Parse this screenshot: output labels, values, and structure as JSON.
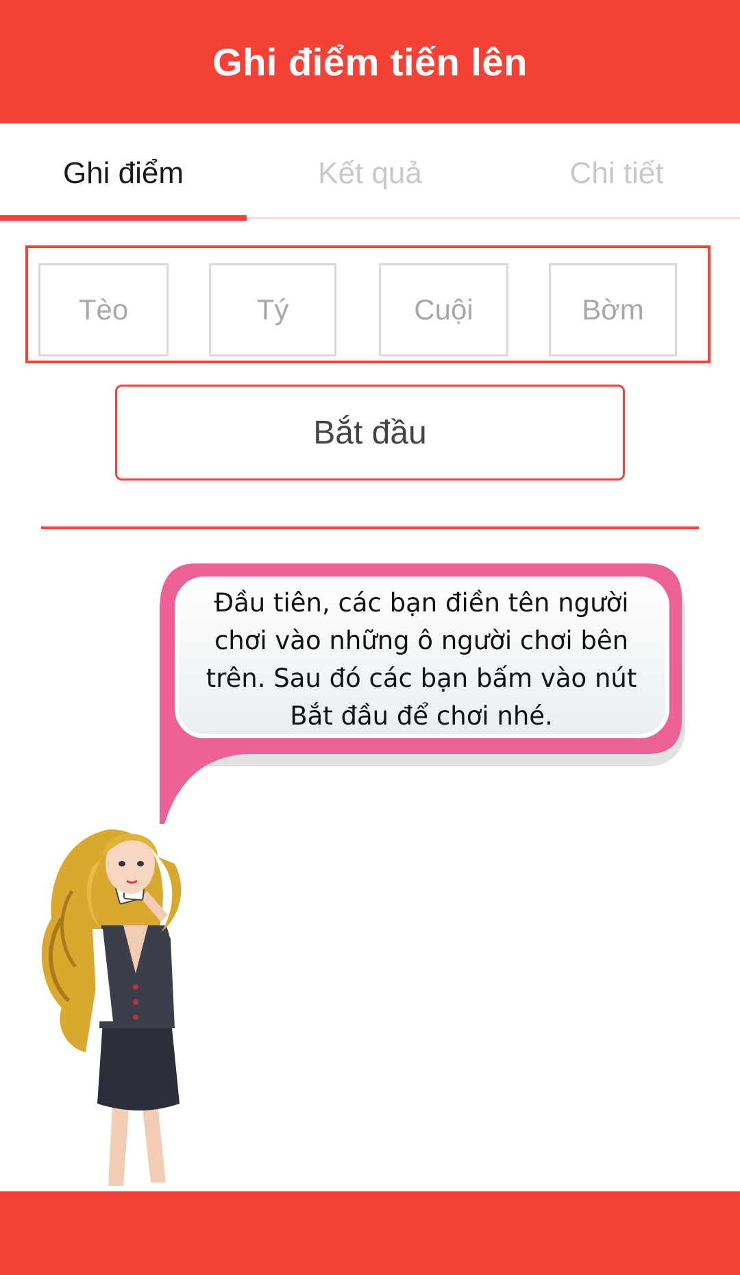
{
  "app": {
    "title": "Ghi điểm tiến lên"
  },
  "colors": {
    "primary": "#f44336",
    "bubble_pink": "#ee6196",
    "tab_inactive": "#c8c8c8"
  },
  "tabs": [
    {
      "label": "Ghi điểm",
      "active": true
    },
    {
      "label": "Kết quả",
      "active": false
    },
    {
      "label": "Chi tiết",
      "active": false
    }
  ],
  "players": [
    {
      "placeholder": "Tèo",
      "value": ""
    },
    {
      "placeholder": "Tý",
      "value": ""
    },
    {
      "placeholder": "Cuội",
      "value": ""
    },
    {
      "placeholder": "Bờm",
      "value": ""
    }
  ],
  "start_button": {
    "label": "Bắt đầu"
  },
  "guide": {
    "message": "Đầu tiên, các bạn điền tên người chơi vào những ô người chơi bên trên. Sau đó các bạn bấm vào nút Bắt đầu để chơi nhé.",
    "character_icon": "card-dealer-girl-icon"
  }
}
